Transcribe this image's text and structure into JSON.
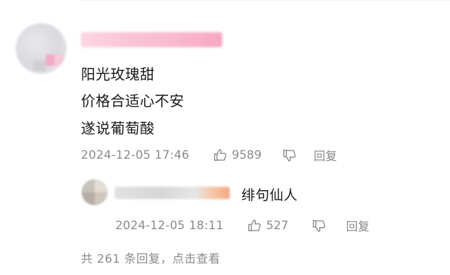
{
  "comment": {
    "lines": [
      "阳光玫瑰甜",
      "价格合适心不安",
      "遂说葡萄酸"
    ],
    "timestamp": "2024-12-05 17:46",
    "like_count": "9589",
    "reply_label": "回复"
  },
  "reply": {
    "text": "绯句仙人",
    "timestamp": "2024-12-05 18:11",
    "like_count": "527",
    "reply_label": "回复"
  },
  "footer": {
    "more_replies": "共 261 条回复，点击查看"
  },
  "icons": {
    "like": "thumbs-up-icon",
    "dislike": "thumbs-down-icon"
  },
  "colors": {
    "text_primary": "#1a1a1a",
    "text_secondary": "#8a8a8a"
  }
}
